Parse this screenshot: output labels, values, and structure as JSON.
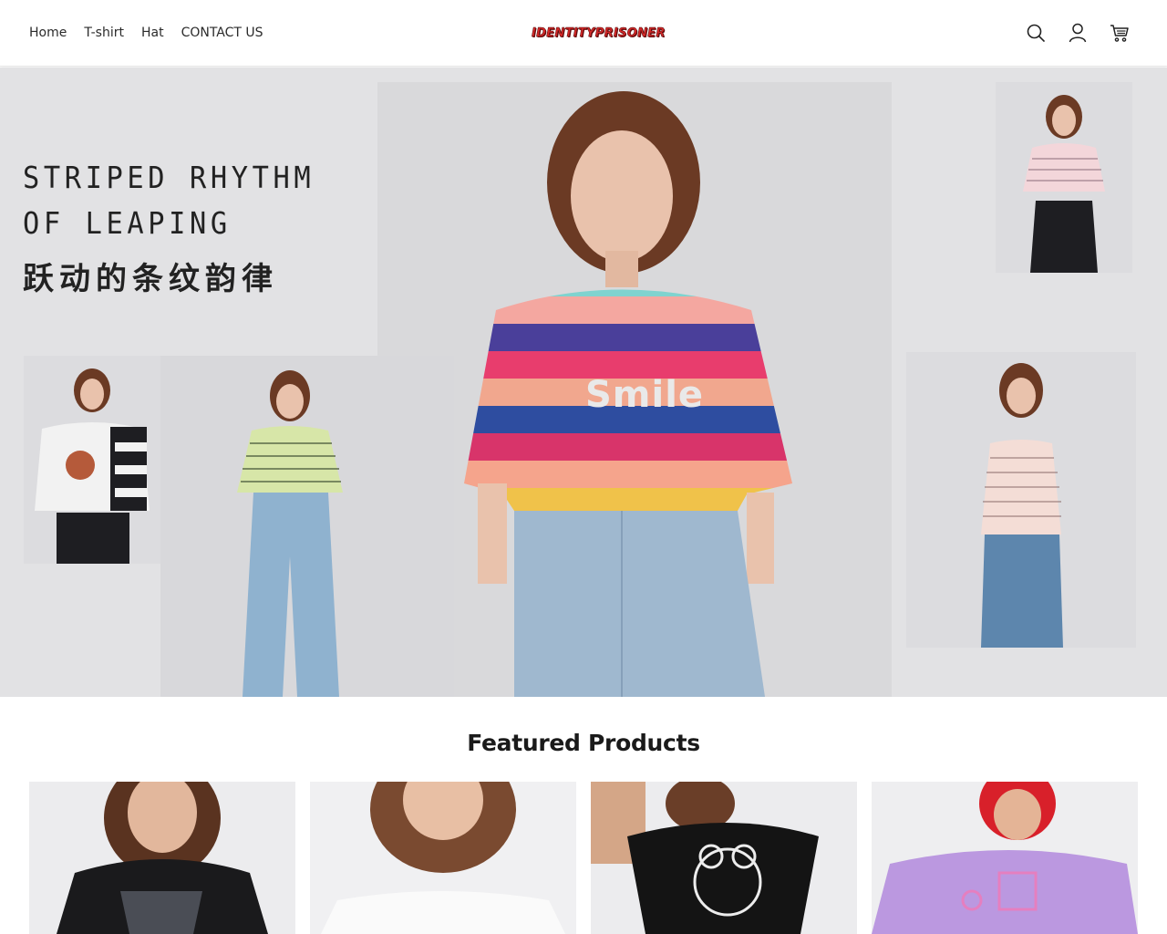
{
  "header": {
    "nav": [
      "Home",
      "T-shirt",
      "Hat",
      "CONTACT US"
    ],
    "logo": "IDENTITYPRISONER",
    "icons": [
      "search-icon",
      "account-icon",
      "cart-icon"
    ]
  },
  "hero": {
    "title": "STRIPED RHYTHM OF LEAPING",
    "subtitle_cn": "跃动的条纹韵律",
    "shirt_text": "Smile"
  },
  "featured": {
    "title": "Featured Products"
  },
  "colors": {
    "logo": "#d62828",
    "hero_bg": "#e2e2e4",
    "text": "#121212"
  }
}
